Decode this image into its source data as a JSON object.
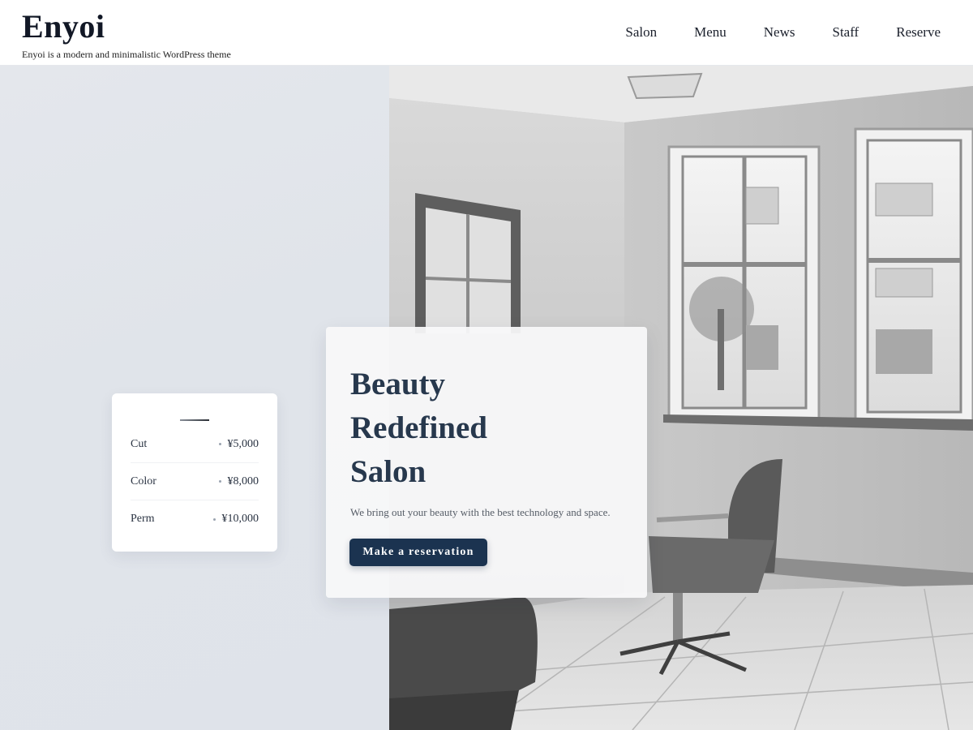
{
  "site": {
    "title": "Enyoi",
    "tagline": "Enyoi is a modern and minimalistic WordPress theme"
  },
  "nav": {
    "items": [
      {
        "label": "Salon"
      },
      {
        "label": "Menu"
      },
      {
        "label": "News"
      },
      {
        "label": "Staff"
      },
      {
        "label": "Reserve"
      }
    ]
  },
  "hero": {
    "title_lines": [
      "Beauty",
      "Redefined",
      "Salon"
    ],
    "subtitle": "We bring out your beauty with the best technology and space.",
    "cta_label": "Make a reservation"
  },
  "price_list": {
    "items": [
      {
        "service": "Cut",
        "price": "¥5,000"
      },
      {
        "service": "Color",
        "price": "¥8,000"
      },
      {
        "service": "Perm",
        "price": "¥10,000"
      }
    ]
  },
  "colors": {
    "accent": "#1b3350",
    "heading": "#27384d",
    "hero_left_bg": "#e1e5eb"
  }
}
